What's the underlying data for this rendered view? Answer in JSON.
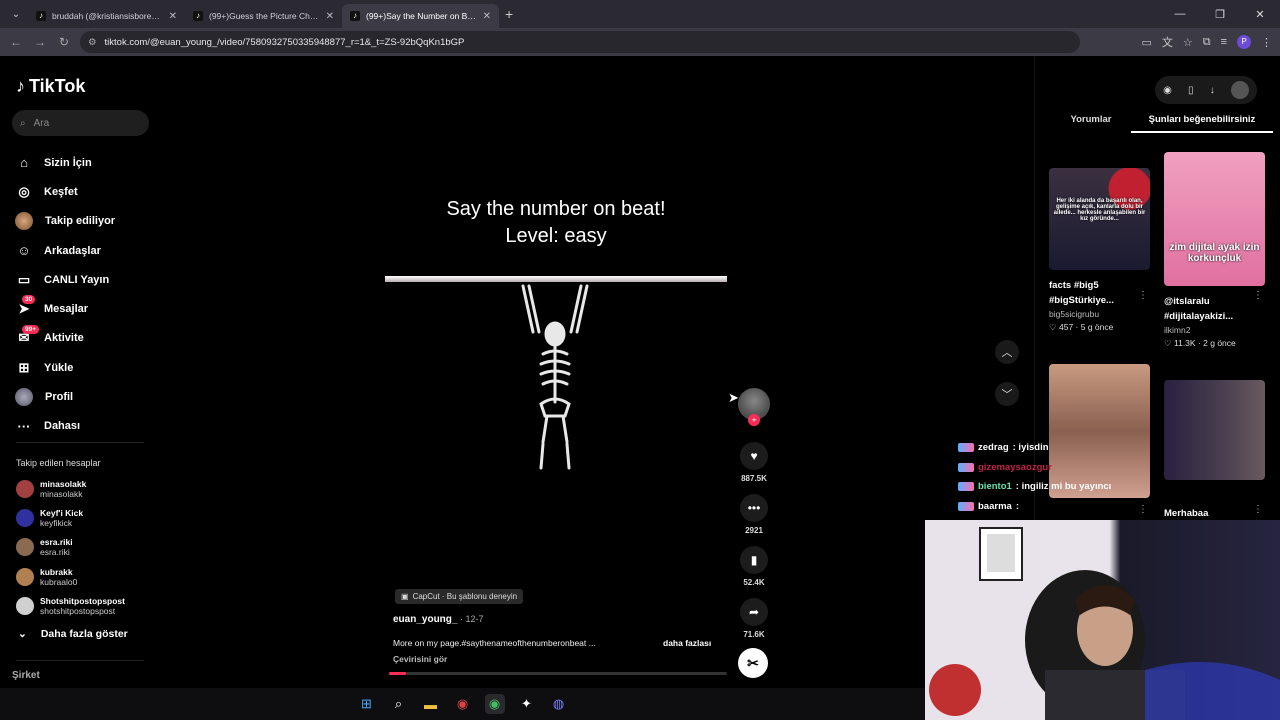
{
  "browser": {
    "tabs": [
      {
        "title": "bruddah (@kristiansisbored) | T",
        "active": false
      },
      {
        "title": "(99+)Guess the Picture Challeng",
        "active": false
      },
      {
        "title": "(99+)Say the Number on Beat",
        "active": true
      }
    ],
    "url": "tiktok.com/@euan_young_/video/7580932750335948877_r=1&_t=ZS-92bQqKn1bGP",
    "profile_initial": "P"
  },
  "sidebar": {
    "logo": "TikTok",
    "search_placeholder": "Ara",
    "nav": [
      {
        "label": "Sizin İçin",
        "icon": "home-icon",
        "glyph": "⌂"
      },
      {
        "label": "Keşfet",
        "icon": "compass-icon",
        "glyph": "◎"
      },
      {
        "label": "Takip ediliyor",
        "icon": "following-avatar-icon",
        "glyph": ""
      },
      {
        "label": "Arkadaşlar",
        "icon": "friends-icon",
        "glyph": "☺"
      },
      {
        "label": "CANLI Yayın",
        "icon": "live-tv-icon",
        "glyph": "▭"
      },
      {
        "label": "Mesajlar",
        "icon": "message-icon",
        "glyph": "➤",
        "badge": "30"
      },
      {
        "label": "Aktivite",
        "icon": "inbox-icon",
        "glyph": "✉",
        "badge": "99+"
      },
      {
        "label": "Yükle",
        "icon": "upload-icon",
        "glyph": "⊞"
      },
      {
        "label": "Profil",
        "icon": "profile-icon",
        "glyph": ""
      },
      {
        "label": "Dahası",
        "icon": "more-dots-icon",
        "glyph": "···"
      }
    ],
    "following_header": "Takip edilen hesaplar",
    "following": [
      {
        "name": "minasolakk",
        "user": "minasolakk",
        "color": "#a04040"
      },
      {
        "name": "Keyf'i Kick",
        "user": "keyfikick",
        "color": "#3030a0"
      },
      {
        "name": "esra.riki",
        "user": "esra.riki",
        "color": "#8a6a50"
      },
      {
        "name": "kubrakk",
        "user": "kubraalo0",
        "color": "#b08050"
      },
      {
        "name": "Shotshitpostopspost",
        "user": "shotshitpostopspost",
        "color": "#d0d0d0"
      }
    ],
    "show_more": "Daha fazla göster",
    "company": "Şirket"
  },
  "video": {
    "title_line1": "Say the number on beat!",
    "title_line2": "Level: easy",
    "capcut_tag": "CapCut · Bu şablonu deneyin",
    "author": "euan_young_",
    "date": " · 12-7",
    "description": "More on my page.#saythenameofthenumberonbeat ...",
    "more": "daha fazlası",
    "translate": "Çevirisini gör",
    "progress": 0.05
  },
  "actions": {
    "likes": "887.5K",
    "comments": "2921",
    "saves": "52.4K",
    "shares": "71.6K"
  },
  "right_panel": {
    "tab_comments": "Yorumlar",
    "tab_suggested": "Şunları beğenebilirsiniz",
    "cards": [
      {
        "caption1": "facts #big5",
        "caption2": "#bigStürkiye...",
        "user": "big5sicigrubu",
        "likes": "457",
        "age": "5 g önce",
        "overlay": "Her iki alanda da başarılı olan, gelişime açık, kanlarla dolu bir ailede... herkesle anlaşabilen bir kız göründe..."
      },
      {
        "caption1": "@itslaralu",
        "caption2": "#dijitalayakizi...",
        "user": "ilkimn2",
        "likes": "11.3K",
        "age": "2 g önce",
        "overlay": "zim dijital ayak izin korkunçluk"
      },
      {
        "caption1": "",
        "caption2": "",
        "user": "",
        "likes": "",
        "age": "",
        "overlay": ""
      },
      {
        "caption1": "Merhabaa",
        "caption2": "",
        "user": "",
        "likes": "",
        "age": "",
        "overlay": ""
      }
    ]
  },
  "chat": [
    {
      "name": "zedrag",
      "msg": ": iyisdin"
    },
    {
      "name": "gizemaysaozgur",
      "msg": ""
    },
    {
      "name": "biento1",
      "msg": ": ingiliz mi bu yayıncı"
    },
    {
      "name": "baarma",
      "msg": ":"
    }
  ],
  "colors": {
    "accent": "#fe2c55"
  }
}
